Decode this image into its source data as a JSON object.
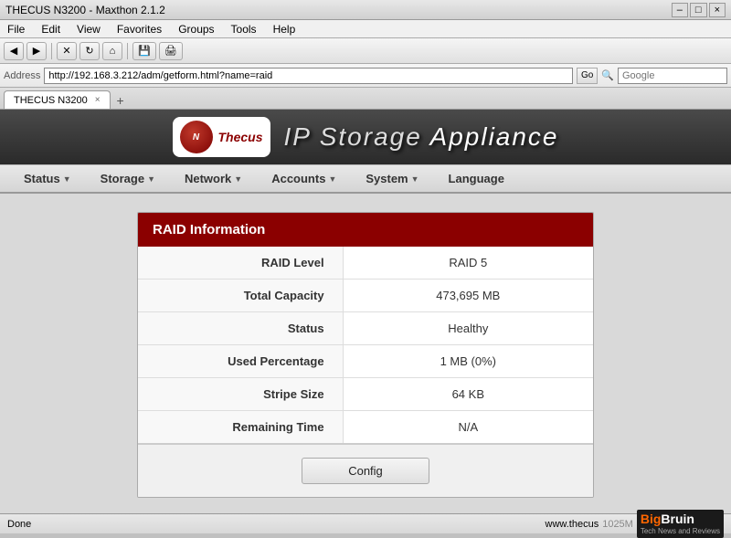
{
  "browser": {
    "title": "THECUS N3200 - Maxthon 2.1.2",
    "menu": {
      "items": [
        "File",
        "Edit",
        "View",
        "Favorites",
        "Groups",
        "Tools",
        "Help"
      ]
    },
    "address": "http://192.168.3.212/adm/getform.html?name=raid",
    "search_placeholder": "Google",
    "tab": {
      "label": "THECUS N3200",
      "close": "×"
    },
    "new_tab": "+"
  },
  "app": {
    "title_part1": "IP Storage",
    "title_part2": " Appliance",
    "logo_text": "Thecus"
  },
  "nav": {
    "items": [
      {
        "label": "Status",
        "has_arrow": true
      },
      {
        "label": "Storage",
        "has_arrow": true
      },
      {
        "label": "Network",
        "has_arrow": true
      },
      {
        "label": "Accounts",
        "has_arrow": true
      },
      {
        "label": "System",
        "has_arrow": true
      },
      {
        "label": "Language",
        "has_arrow": false
      }
    ]
  },
  "raid_info": {
    "title": "RAID Information",
    "rows": [
      {
        "label": "RAID Level",
        "value": "RAID 5"
      },
      {
        "label": "Total Capacity",
        "value": "473,695 MB"
      },
      {
        "label": "Status",
        "value": "Healthy"
      },
      {
        "label": "Used Percentage",
        "value": "1 MB (0%)"
      },
      {
        "label": "Stripe Size",
        "value": "64 KB"
      },
      {
        "label": "Remaining Time",
        "value": "N/A"
      }
    ],
    "config_button": "Config"
  },
  "statusbar": {
    "left": "Done",
    "memory": "1025M",
    "bigbruin": {
      "big": "Big",
      "bruin": "Bruin",
      "sub": "Tech News and Reviews"
    },
    "site": "www.thecus"
  }
}
